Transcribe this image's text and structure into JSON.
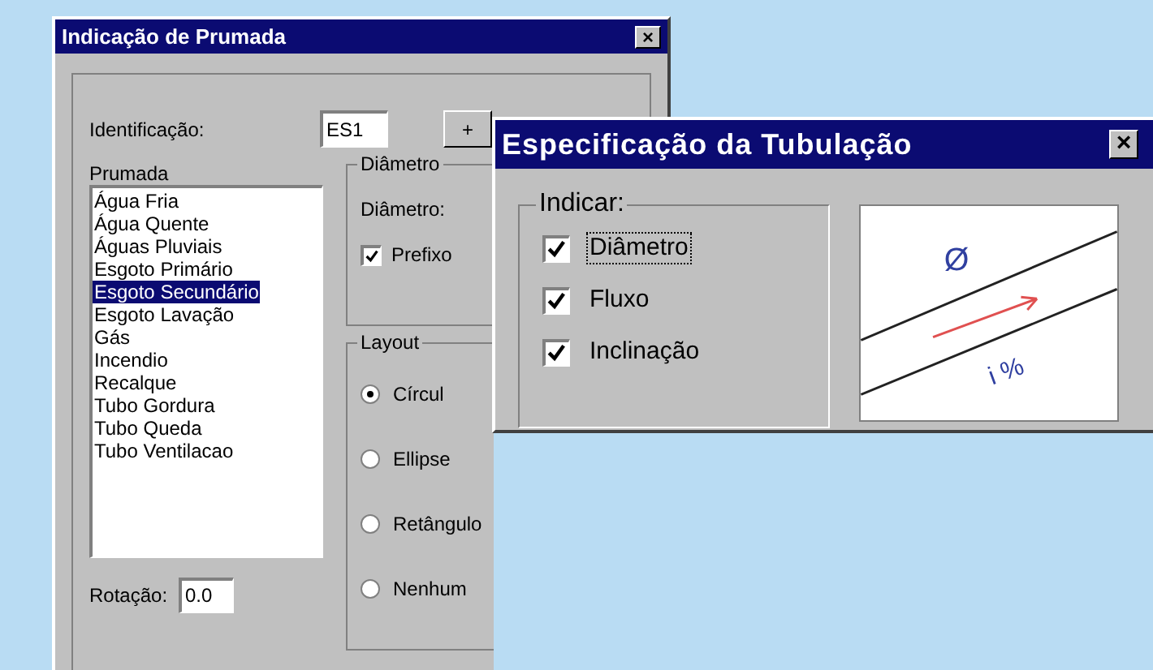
{
  "main_dialog": {
    "title": "Indicação de Prumada",
    "close": "×",
    "identification": {
      "label": "Identificação:",
      "value": "ES1",
      "button": "+"
    },
    "prumada": {
      "label": "Prumada",
      "items": [
        {
          "label": "Água Fria",
          "selected": false
        },
        {
          "label": "Água Quente",
          "selected": false
        },
        {
          "label": "Águas Pluviais",
          "selected": false
        },
        {
          "label": "Esgoto Primário",
          "selected": false
        },
        {
          "label": "Esgoto Secundário",
          "selected": true
        },
        {
          "label": "Esgoto Lavação",
          "selected": false
        },
        {
          "label": "Gás",
          "selected": false
        },
        {
          "label": "Incendio",
          "selected": false
        },
        {
          "label": "Recalque",
          "selected": false
        },
        {
          "label": "Tubo Gordura",
          "selected": false
        },
        {
          "label": "Tubo Queda",
          "selected": false
        },
        {
          "label": "Tubo Ventilacao",
          "selected": false
        }
      ]
    },
    "rotation": {
      "label": "Rotação:",
      "value": "0.0"
    },
    "diameter_group": {
      "title": "Diâmetro",
      "field_label": "Diâmetro:",
      "prefix": {
        "label": "Prefixo",
        "checked": true
      }
    },
    "layout_group": {
      "title": "Layout",
      "options": [
        {
          "label": "Círcul",
          "selected": true
        },
        {
          "label": "Ellipse",
          "selected": false
        },
        {
          "label": "Retângulo",
          "selected": false
        },
        {
          "label": "Nenhum",
          "selected": false
        }
      ]
    }
  },
  "spec_dialog": {
    "title": "Especificação da Tubulação",
    "close": "×",
    "indicate": {
      "title": "Indicar:",
      "options": [
        {
          "label": "Diâmetro",
          "checked": true,
          "focused": true
        },
        {
          "label": "Fluxo",
          "checked": true,
          "focused": false
        },
        {
          "label": "Inclinação",
          "checked": true,
          "focused": false
        }
      ]
    },
    "preview": {
      "diameter_symbol": "Ø",
      "slope_label": "i %"
    }
  }
}
